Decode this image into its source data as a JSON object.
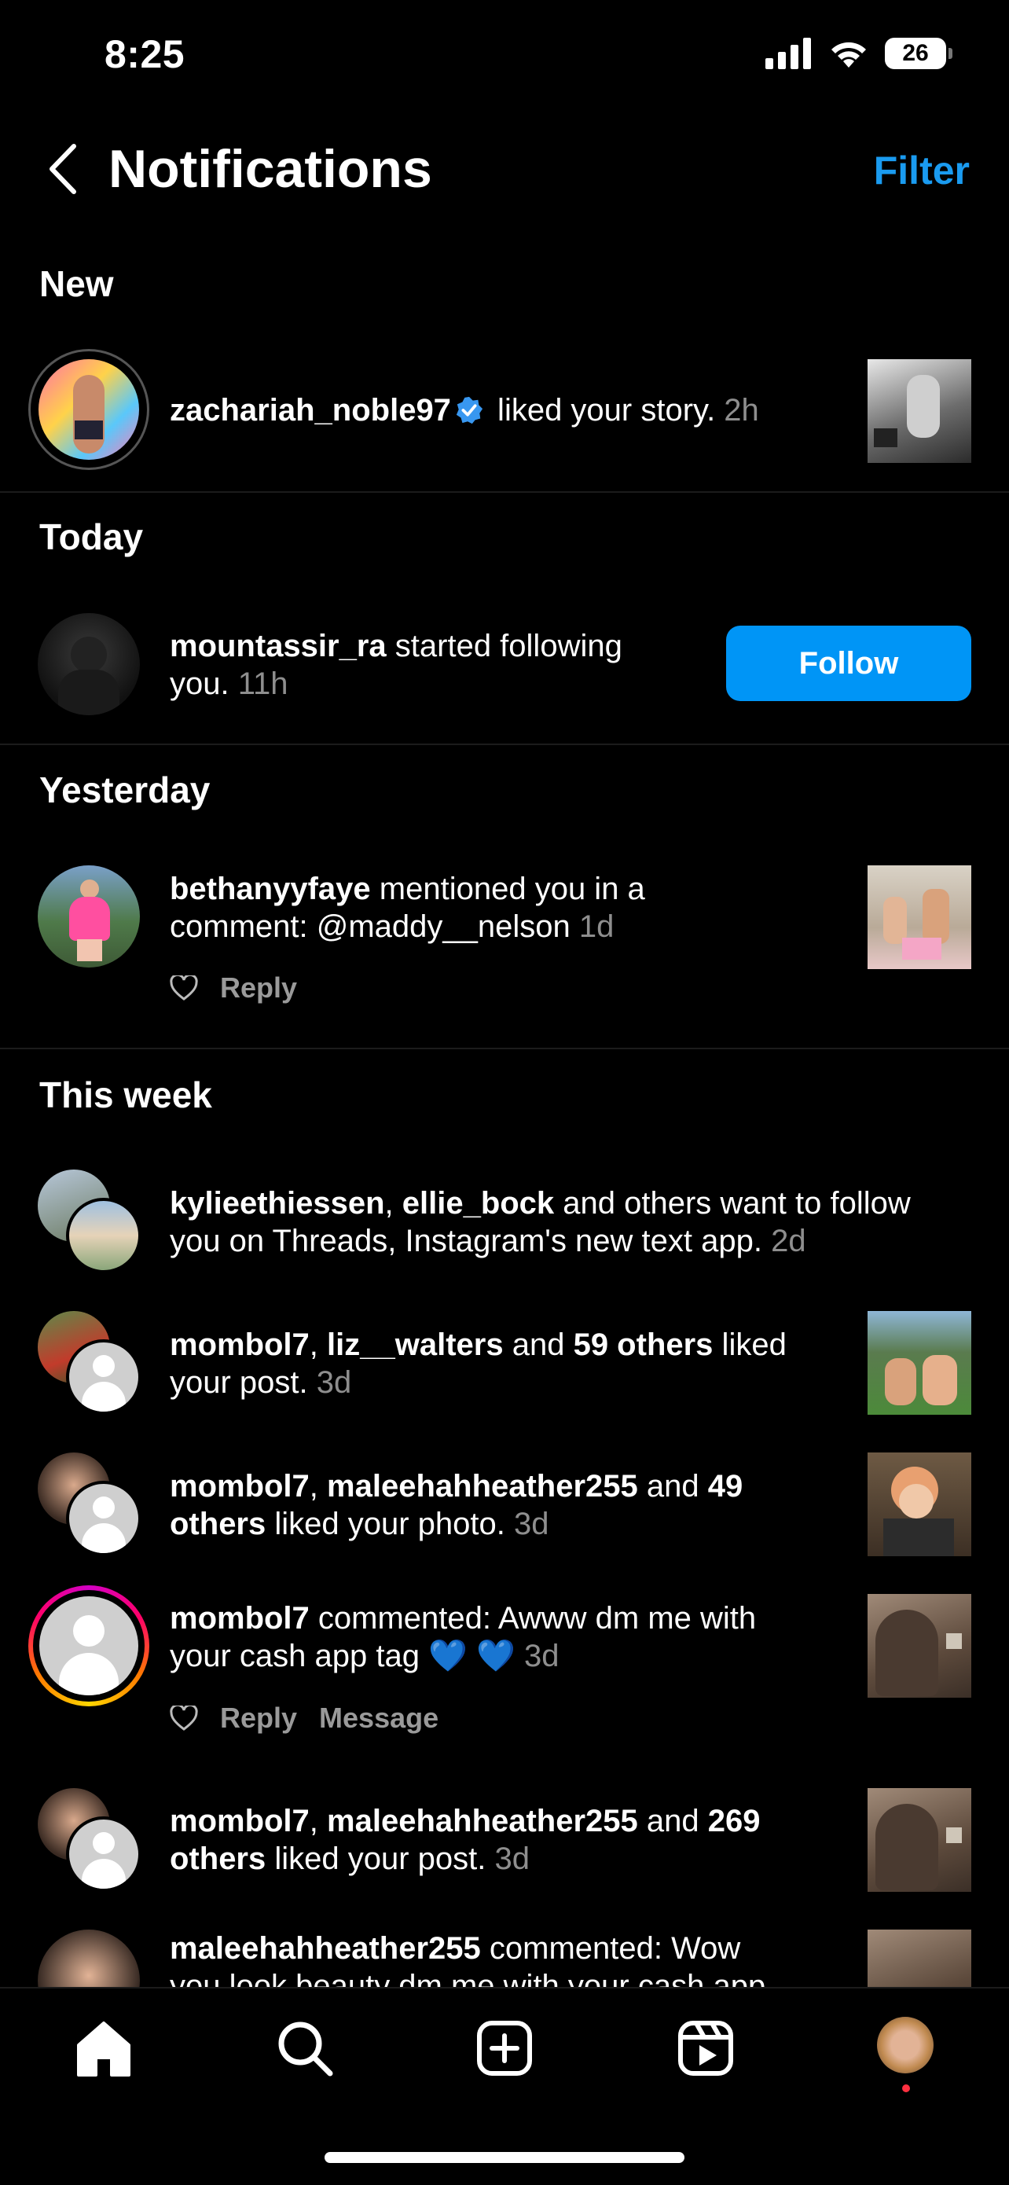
{
  "status": {
    "time": "8:25",
    "battery": "26"
  },
  "header": {
    "title": "Notifications",
    "filter": "Filter"
  },
  "sections": {
    "new": "New",
    "today": "Today",
    "yesterday": "Yesterday",
    "week": "This week"
  },
  "n1": {
    "user": "zachariah_noble97",
    "text": " liked your story. ",
    "time": "2h"
  },
  "n2": {
    "user": "mountassir_ra",
    "text1": " started following",
    "text2": "you. ",
    "time": "11h",
    "button": "Follow"
  },
  "n3": {
    "user": "bethanyyfaye",
    "text1": " mentioned you in a",
    "text2": "comment: @maddy__nelson ",
    "time": "1d",
    "reply": "Reply"
  },
  "n4": {
    "user1": "kylieethiessen",
    "sep": ", ",
    "user2": "ellie_bock",
    "text1": " and others want to follow",
    "text2": "you on Threads, Instagram's new text app. ",
    "time": "2d"
  },
  "n5": {
    "user1": "mombol7",
    "sep": ", ",
    "user2": "liz__walters",
    "and": " and ",
    "others": "59 others",
    "text1": " liked",
    "text2": "your post. ",
    "time": "3d"
  },
  "n6": {
    "user1": "mombol7",
    "sep": ", ",
    "user2": "maleehahheather255",
    "and": " and ",
    "num": "49",
    "others": "others",
    "text2": " liked your photo. ",
    "time": "3d"
  },
  "n7": {
    "user": "mombol7",
    "text1": " commented: Awww dm me with",
    "text2": "your cash app tag ",
    "emoji": "💙 💙",
    "time": "3d",
    "reply": "Reply",
    "message": "Message"
  },
  "n8": {
    "user1": "mombol7",
    "sep": ", ",
    "user2": "maleehahheather255",
    "and": " and ",
    "num": "269",
    "others": "others",
    "text2": " liked your post. ",
    "time": "3d"
  },
  "n9": {
    "user": "maleehahheather255",
    "text1": " commented: Wow",
    "text2": "you look beauty dm me with your cash app"
  },
  "colors": {
    "accent": "#0095f6",
    "filter": "#1a9bf0",
    "verified": "#3897f0",
    "background": "#000000"
  },
  "tabs": [
    "home-icon",
    "search-icon",
    "create-icon",
    "reels-icon",
    "profile-avatar"
  ]
}
